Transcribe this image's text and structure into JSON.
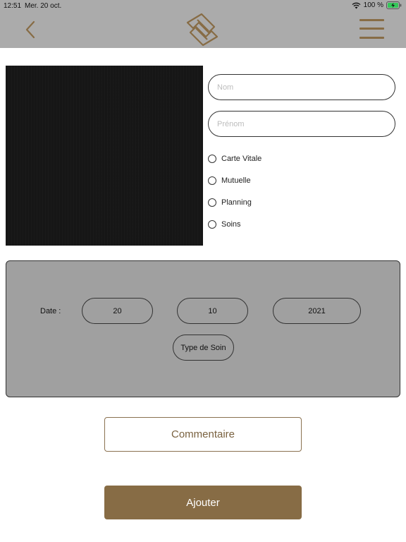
{
  "status_bar": {
    "time": "12:51",
    "date": "Mer. 20 oct.",
    "battery": "100 %",
    "icons": [
      "wifi-icon",
      "battery-charging-icon"
    ]
  },
  "header": {
    "back_icon": "chevron-left-icon",
    "logo_icon": "interlocking-s-logo",
    "menu_icon": "hamburger-menu-icon",
    "accent_color": "#876c45",
    "background_color": "#ababab"
  },
  "form": {
    "nom_placeholder": "Nom",
    "nom_value": "",
    "prenom_placeholder": "Prénom",
    "prenom_value": "",
    "options": [
      {
        "label": "Carte Vitale",
        "checked": false
      },
      {
        "label": "Mutuelle",
        "checked": false
      },
      {
        "label": "Planning",
        "checked": false
      },
      {
        "label": "Soins",
        "checked": false
      }
    ]
  },
  "date_panel": {
    "label": "Date :",
    "day": "20",
    "month": "10",
    "year": "2021",
    "type_button": "Type de Soin"
  },
  "actions": {
    "comment": "Commentaire",
    "add": "Ajouter"
  }
}
